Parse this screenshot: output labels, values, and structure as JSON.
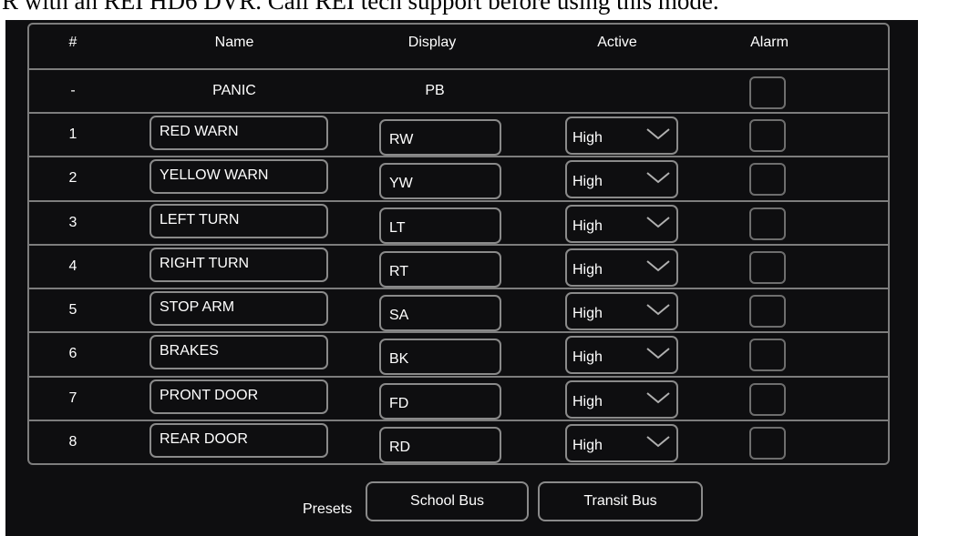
{
  "banner_text": "R with an REI HD6 DVR.  Call REI tech support before using this mode.",
  "table": {
    "headers": {
      "num": "#",
      "name": "Name",
      "display": "Display",
      "active": "Active",
      "alarm": "Alarm"
    },
    "panic_row": {
      "num": "-",
      "name": "PANIC",
      "display": "PB"
    },
    "rows": [
      {
        "num": "1",
        "name": "RED WARN",
        "display": "RW",
        "active": "High"
      },
      {
        "num": "2",
        "name": "YELLOW WARN",
        "display": "YW",
        "active": "High"
      },
      {
        "num": "3",
        "name": "LEFT TURN",
        "display": "LT",
        "active": "High"
      },
      {
        "num": "4",
        "name": "RIGHT TURN",
        "display": "RT",
        "active": "High"
      },
      {
        "num": "5",
        "name": "STOP ARM",
        "display": "SA",
        "active": "High"
      },
      {
        "num": "6",
        "name": "BRAKES",
        "display": "BK",
        "active": "High"
      },
      {
        "num": "7",
        "name": "PRONT DOOR",
        "display": "FD",
        "active": "High"
      },
      {
        "num": "8",
        "name": "REAR DOOR",
        "display": "RD",
        "active": "High"
      }
    ]
  },
  "presets": {
    "label": "Presets",
    "school_bus": "School Bus",
    "transit_bus": "Transit Bus"
  },
  "colors": {
    "background": "#0e0e10",
    "border": "#7d7d7d",
    "text": "#ffffff"
  },
  "icons": {
    "dropdown": "chevron-down-icon",
    "alarm": "checkbox"
  }
}
